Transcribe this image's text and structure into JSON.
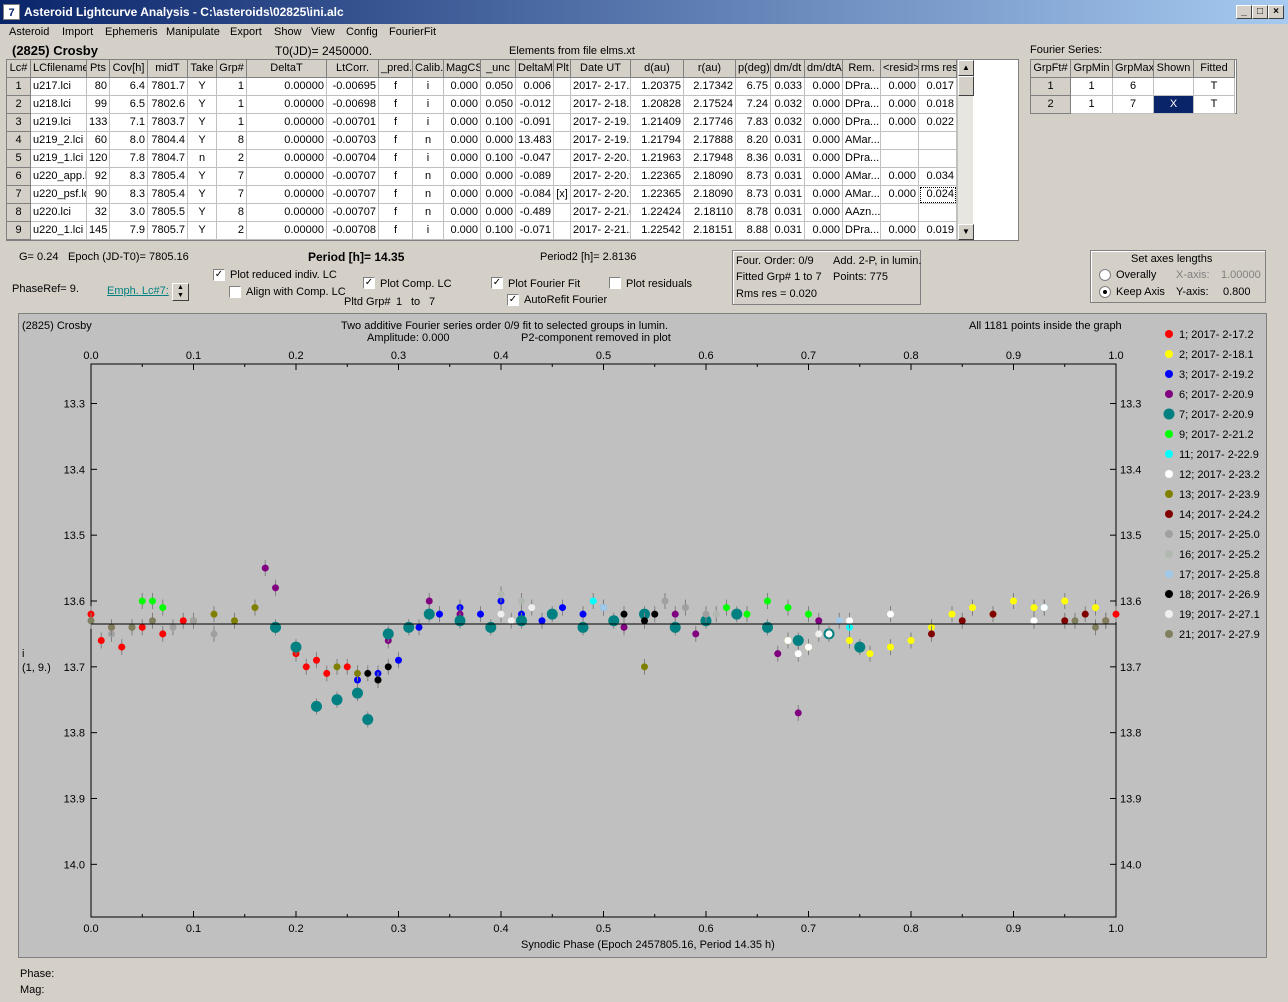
{
  "window": {
    "title": "Asteroid Lightcurve Analysis - C:\\asteroids\\02825\\ini.alc",
    "icon_label": "7"
  },
  "menu": [
    "Asteroid",
    "Import",
    "Ephemeris",
    "Manipulate",
    "Export",
    "Show",
    "View",
    "Config",
    "FourierFit"
  ],
  "header": {
    "asteroid": "(2825) Crosby",
    "t0": "T0(JD)= 2450000.",
    "elements": "Elements from file elms.xt"
  },
  "lc_table": {
    "columns": [
      "Lc#",
      "LCfilename",
      "Pts",
      "Cov[h]",
      "midT",
      "Take",
      "Grp#",
      "DeltaT",
      "LtCorr.",
      "_pred.",
      "Calib.",
      "MagCS",
      "_unc",
      "DeltaM",
      "Plt",
      "Date UT",
      "d(au)",
      "r(au)",
      "p(deg)",
      "dm/dt",
      "dm/dtA",
      "Rem.",
      "<resid>",
      "rms res"
    ],
    "rows": [
      [
        "1",
        "u217.lci",
        "80",
        "6.4",
        "7801.7",
        "Y",
        "1",
        "0.00000",
        "-0.00695",
        "f",
        "i",
        "0.000",
        "0.050",
        "0.006",
        "",
        "2017- 2-17.2",
        "1.20375",
        "2.17342",
        "6.75",
        "0.033",
        "0.000",
        "DPra...",
        "0.000",
        "0.017"
      ],
      [
        "2",
        "u218.lci",
        "99",
        "6.5",
        "7802.6",
        "Y",
        "1",
        "0.00000",
        "-0.00698",
        "f",
        "i",
        "0.000",
        "0.050",
        "-0.012",
        "",
        "2017- 2-18.1",
        "1.20828",
        "2.17524",
        "7.24",
        "0.032",
        "0.000",
        "DPra...",
        "0.000",
        "0.018"
      ],
      [
        "3",
        "u219.lci",
        "133",
        "7.1",
        "7803.7",
        "Y",
        "1",
        "0.00000",
        "-0.00701",
        "f",
        "i",
        "0.000",
        "0.100",
        "-0.091",
        "",
        "2017- 2-19.2",
        "1.21409",
        "2.17746",
        "7.83",
        "0.032",
        "0.000",
        "DPra...",
        "0.000",
        "0.022"
      ],
      [
        "4",
        "u219_2.lci",
        "60",
        "8.0",
        "7804.4",
        "Y",
        "8",
        "0.00000",
        "-0.00703",
        "f",
        "n",
        "0.000",
        "0.000",
        "13.483",
        "",
        "2017- 2-19.9",
        "1.21794",
        "2.17888",
        "8.20",
        "0.031",
        "0.000",
        "AMar...",
        "",
        ""
      ],
      [
        "5",
        "u219_1.lci",
        "120",
        "7.8",
        "7804.7",
        "n",
        "2",
        "0.00000",
        "-0.00704",
        "f",
        "i",
        "0.000",
        "0.100",
        "-0.047",
        "",
        "2017- 2-20.2",
        "1.21963",
        "2.17948",
        "8.36",
        "0.031",
        "0.000",
        "DPra...",
        "",
        ""
      ],
      [
        "6",
        "u220_app.lc",
        "92",
        "8.3",
        "7805.4",
        "Y",
        "7",
        "0.00000",
        "-0.00707",
        "f",
        "n",
        "0.000",
        "0.000",
        "-0.089",
        "",
        "2017- 2-20.9",
        "1.22365",
        "2.18090",
        "8.73",
        "0.031",
        "0.000",
        "AMar...",
        "0.000",
        "0.034"
      ],
      [
        "7",
        "u220_psf.lc",
        "90",
        "8.3",
        "7805.4",
        "Y",
        "7",
        "0.00000",
        "-0.00707",
        "f",
        "n",
        "0.000",
        "0.000",
        "-0.084",
        "[x]",
        "2017- 2-20.9",
        "1.22365",
        "2.18090",
        "8.73",
        "0.031",
        "0.000",
        "AMar...",
        "0.000",
        "0.024"
      ],
      [
        "8",
        "u220.lci",
        "32",
        "3.0",
        "7805.5",
        "Y",
        "8",
        "0.00000",
        "-0.00707",
        "f",
        "n",
        "0.000",
        "0.000",
        "-0.489",
        "",
        "2017- 2-21.0",
        "1.22424",
        "2.18110",
        "8.78",
        "0.031",
        "0.000",
        "AAzn...",
        "",
        ""
      ],
      [
        "9",
        "u220_1.lci",
        "145",
        "7.9",
        "7805.7",
        "Y",
        "2",
        "0.00000",
        "-0.00708",
        "f",
        "i",
        "0.000",
        "0.100",
        "-0.071",
        "",
        "2017- 2-21.2",
        "1.22542",
        "2.18151",
        "8.88",
        "0.031",
        "0.000",
        "DPra...",
        "0.000",
        "0.019"
      ]
    ]
  },
  "fourier_series": {
    "title": "Fourier Series:",
    "columns": [
      "GrpFt#",
      "GrpMin",
      "GrpMax",
      "Shown",
      "Fitted"
    ],
    "rows": [
      [
        "1",
        "1",
        "6",
        "",
        "T"
      ],
      [
        "2",
        "1",
        "7",
        "X",
        "T"
      ]
    ]
  },
  "controls": {
    "g": "G= 0.24",
    "epoch": "Epoch (JD-T0)= 7805.16",
    "period": "Period [h]= 14.35",
    "period2": "Period2 [h]= 2.8136",
    "phaseref": "PhaseRef= 9.",
    "emph": "Emph. Lc#7:",
    "plot_reduced": "Plot reduced indiv. LC",
    "align_comp": "Align with Comp. LC",
    "plot_comp": "Plot Comp. LC",
    "pltd_grp": "Pltd Grp#",
    "pltd_from": "1",
    "pltd_to_label": "to",
    "pltd_to": "7",
    "plot_fourier": "Plot Fourier Fit",
    "autorefit": "AutoRefit Fourier",
    "plot_residuals": "Plot residuals",
    "four_order": "Four. Order:  0/9",
    "add2p": "Add. 2-P, in lumin.",
    "fitted_grp": "Fitted Grp# 1 to 7",
    "points": "Points: 775",
    "rms": "Rms res     = 0.020",
    "axes_title": "Set axes lengths",
    "overally": "Overally",
    "keep_axis": "Keep Axis",
    "xaxis_label": "X-axis:",
    "xaxis_val": "1.00000",
    "yaxis_label": "Y-axis:",
    "yaxis_val": "0.800"
  },
  "plot": {
    "name": "(2825) Crosby",
    "title1": "Two additive Fourier series order 0/9 fit to selected groups in lumin.",
    "title2": "Amplitude: 0.000",
    "title3": "P2-component removed in plot",
    "points_note": "All 1181 points inside the graph",
    "ylabel1": "i",
    "ylabel2": "(1, 9.)",
    "xlabel": "Synodic Phase (Epoch 2457805.16, Period 14.35 h)"
  },
  "chart_data": {
    "type": "scatter",
    "x_ticks": [
      "0.0",
      "0.1",
      "0.2",
      "0.3",
      "0.4",
      "0.5",
      "0.6",
      "0.7",
      "0.8",
      "0.9",
      "1.0"
    ],
    "y_ticks": [
      "13.3",
      "13.4",
      "13.5",
      "13.6",
      "13.7",
      "13.8",
      "13.9",
      "14.0"
    ],
    "xlim": [
      0,
      1
    ],
    "ylim": [
      13.24,
      14.08
    ],
    "fit_line_mag": 13.635,
    "series": [
      {
        "name": "1; 2017- 2-17.2",
        "color": "#ff0000",
        "x": [
          0.0,
          0.01,
          0.02,
          0.03,
          0.05,
          0.07,
          0.09,
          0.2,
          0.21,
          0.22,
          0.23,
          0.25,
          0.99,
          1.0
        ],
        "y": [
          13.62,
          13.66,
          13.64,
          13.67,
          13.64,
          13.65,
          13.63,
          13.68,
          13.7,
          13.69,
          13.71,
          13.7,
          13.63,
          13.62
        ]
      },
      {
        "name": "2; 2017- 2-18.1",
        "color": "#ffff00",
        "x": [
          0.66,
          0.68,
          0.7,
          0.72,
          0.74,
          0.76,
          0.78,
          0.8,
          0.82,
          0.84,
          0.86,
          0.88,
          0.9,
          0.92,
          0.95,
          0.98
        ],
        "y": [
          13.64,
          13.66,
          13.67,
          13.65,
          13.66,
          13.68,
          13.67,
          13.66,
          13.64,
          13.62,
          13.61,
          13.62,
          13.6,
          13.61,
          13.6,
          13.61
        ]
      },
      {
        "name": "3; 2017- 2-19.2",
        "color": "#0000ff",
        "x": [
          0.26,
          0.28,
          0.3,
          0.32,
          0.34,
          0.36,
          0.38,
          0.4,
          0.42,
          0.44,
          0.46,
          0.48
        ],
        "y": [
          13.72,
          13.71,
          13.69,
          13.64,
          13.62,
          13.61,
          13.62,
          13.6,
          13.62,
          13.63,
          13.61,
          13.62
        ]
      },
      {
        "name": "6; 2017- 2-20.9",
        "color": "#800080",
        "x": [
          0.17,
          0.18,
          0.29,
          0.33,
          0.36,
          0.5,
          0.52,
          0.57,
          0.59,
          0.67,
          0.69,
          0.71
        ],
        "y": [
          13.55,
          13.58,
          13.66,
          13.6,
          13.62,
          13.61,
          13.64,
          13.62,
          13.65,
          13.68,
          13.77,
          13.63
        ]
      },
      {
        "name": "7; 2017- 2-20.9",
        "color": "#008080",
        "big": true,
        "x": [
          0.18,
          0.2,
          0.22,
          0.24,
          0.26,
          0.27,
          0.29,
          0.31,
          0.33,
          0.36,
          0.39,
          0.42,
          0.45,
          0.48,
          0.51,
          0.54,
          0.57,
          0.6,
          0.63,
          0.66,
          0.69,
          0.72,
          0.75
        ],
        "y": [
          13.64,
          13.67,
          13.76,
          13.75,
          13.74,
          13.78,
          13.65,
          13.64,
          13.62,
          13.63,
          13.64,
          13.63,
          13.62,
          13.64,
          13.63,
          13.62,
          13.64,
          13.63,
          13.62,
          13.64,
          13.66,
          13.65,
          13.67
        ]
      },
      {
        "name": "9; 2017- 2-21.2",
        "color": "#00ff00",
        "x": [
          0.05,
          0.06,
          0.07,
          0.62,
          0.64,
          0.66,
          0.68,
          0.7
        ],
        "y": [
          13.6,
          13.6,
          13.61,
          13.61,
          13.62,
          13.6,
          13.61,
          13.62
        ]
      },
      {
        "name": "11; 2017- 2-22.9",
        "color": "#00ffff",
        "x": [
          0.49,
          0.5,
          0.74,
          0.93
        ],
        "y": [
          13.6,
          13.61,
          13.64,
          13.61
        ]
      },
      {
        "name": "12; 2017- 2-23.2",
        "color": "#ffffff",
        "x": [
          0.68,
          0.69,
          0.7,
          0.72,
          0.74,
          0.78,
          0.92,
          0.93
        ],
        "y": [
          13.66,
          13.68,
          13.67,
          13.65,
          13.63,
          13.62,
          13.63,
          13.61
        ]
      },
      {
        "name": "13; 2017- 2-23.9",
        "color": "#808000",
        "x": [
          0.04,
          0.1,
          0.12,
          0.14,
          0.16,
          0.24,
          0.26,
          0.28,
          0.54
        ],
        "y": [
          13.64,
          13.63,
          13.62,
          13.63,
          13.61,
          13.7,
          13.71,
          13.72,
          13.7
        ]
      },
      {
        "name": "14; 2017- 2-24.2",
        "color": "#800000",
        "x": [
          0.82,
          0.85,
          0.88,
          0.95,
          0.97
        ],
        "y": [
          13.65,
          13.63,
          13.62,
          13.63,
          13.62
        ]
      },
      {
        "name": "15; 2017- 2-25.0",
        "color": "#a0a0a0",
        "x": [
          0.02,
          0.08,
          0.1,
          0.12,
          0.56,
          0.58,
          0.6
        ],
        "y": [
          13.65,
          13.64,
          13.63,
          13.65,
          13.6,
          13.61,
          13.62
        ]
      },
      {
        "name": "16; 2017- 2-25.2",
        "color": "#b0b8b0",
        "x": [
          0.4,
          0.42,
          0.61
        ],
        "y": [
          13.59,
          13.6,
          13.62
        ]
      },
      {
        "name": "17; 2017- 2-25.8",
        "color": "#a0c8e8",
        "x": [
          0.5,
          0.52,
          0.73
        ],
        "y": [
          13.61,
          13.62,
          13.63
        ]
      },
      {
        "name": "18; 2017- 2-26.9",
        "color": "#000000",
        "x": [
          0.27,
          0.28,
          0.29,
          0.52,
          0.54,
          0.55
        ],
        "y": [
          13.71,
          13.72,
          13.7,
          13.62,
          13.63,
          13.62
        ]
      },
      {
        "name": "19; 2017- 2-27.1",
        "color": "#f0f0f0",
        "x": [
          0.4,
          0.41,
          0.43,
          0.71
        ],
        "y": [
          13.62,
          13.63,
          13.61,
          13.65
        ]
      },
      {
        "name": "21; 2017- 2-27.9",
        "color": "#808060",
        "x": [
          0.0,
          0.02,
          0.04,
          0.06,
          0.96,
          0.98,
          0.99
        ],
        "y": [
          13.63,
          13.64,
          13.64,
          13.63,
          13.63,
          13.64,
          13.63
        ]
      }
    ]
  }
}
